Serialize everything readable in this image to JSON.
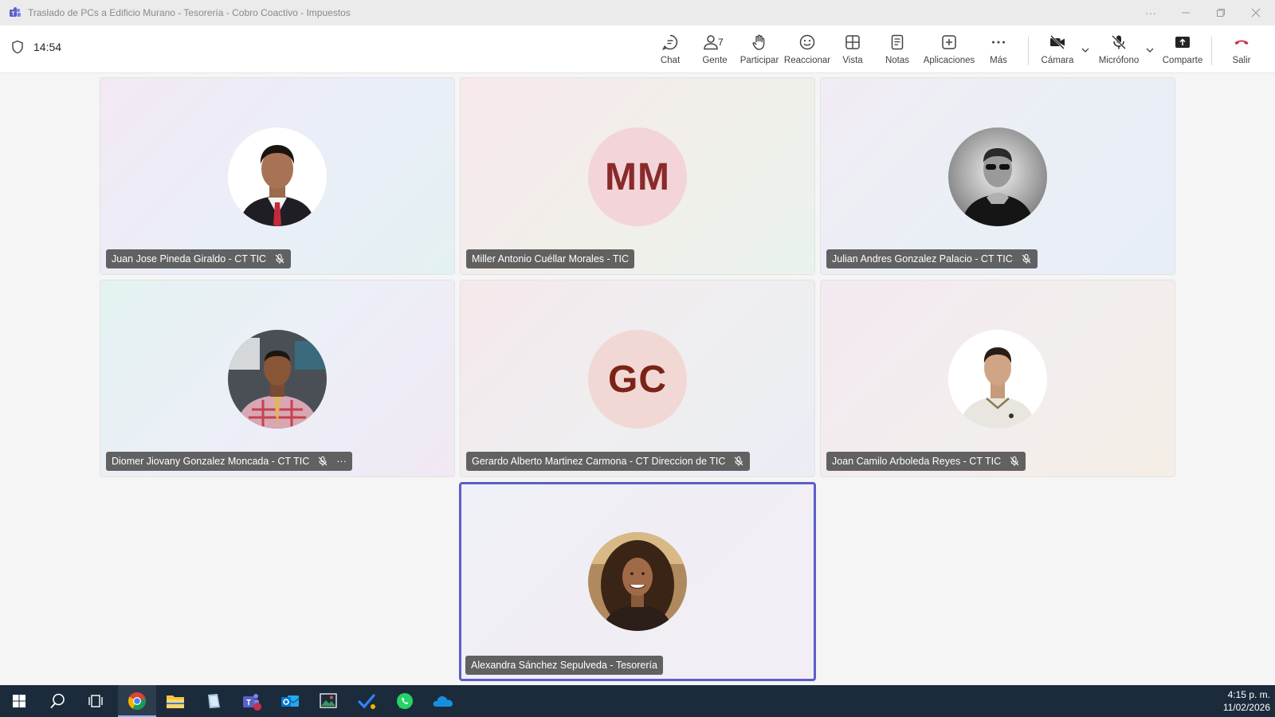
{
  "window": {
    "title": "Traslado de PCs a Edificio Murano - Tesorería - Cobro Coactivo - Impuestos",
    "more_icon": "ellipsis-icon"
  },
  "toolbar": {
    "timer": "14:54",
    "chat": "Chat",
    "people": "Gente",
    "people_count": "7",
    "raise": "Participar",
    "react": "Reaccionar",
    "view": "Vista",
    "notes": "Notas",
    "apps": "Aplicaciones",
    "more": "Más",
    "camera": "Cámara",
    "mic": "Micrófono",
    "share": "Comparte",
    "leave": "Salir",
    "leave_color": "#c4314b"
  },
  "participants": [
    {
      "name": "Juan Jose Pineda Giraldo - CT TIC",
      "muted": true,
      "avatar": "photo"
    },
    {
      "name": "Miller Antonio Cuéllar Morales - TIC",
      "muted": false,
      "avatar": "initials",
      "initials": "MM"
    },
    {
      "name": "Julian Andres Gonzalez Palacio - CT TIC",
      "muted": true,
      "avatar": "photo"
    },
    {
      "name": "Diomer Jiovany Gonzalez Moncada - CT TIC",
      "muted": true,
      "avatar": "photo",
      "more": "···"
    },
    {
      "name": "Gerardo Alberto Martinez Carmona - CT Direccion de TIC",
      "muted": true,
      "avatar": "initials",
      "initials": "GC"
    },
    {
      "name": "Joan Camilo Arboleda Reyes - CT TIC",
      "muted": true,
      "avatar": "photo"
    },
    {
      "name": "Alexandra Sánchez Sepulveda - Tesorería",
      "muted": false,
      "avatar": "photo",
      "speaking": true
    }
  ],
  "taskbar": {
    "apps": [
      "windows-start-icon",
      "search-icon",
      "task-view-icon",
      "chrome-icon",
      "file-explorer-icon",
      "notes-app-icon",
      "teams-icon",
      "outlook-icon",
      "photos-icon",
      "todo-icon",
      "whatsapp-icon",
      "onedrive-icon"
    ],
    "time": "4:15 p. m.",
    "date": "11/02/2026"
  }
}
